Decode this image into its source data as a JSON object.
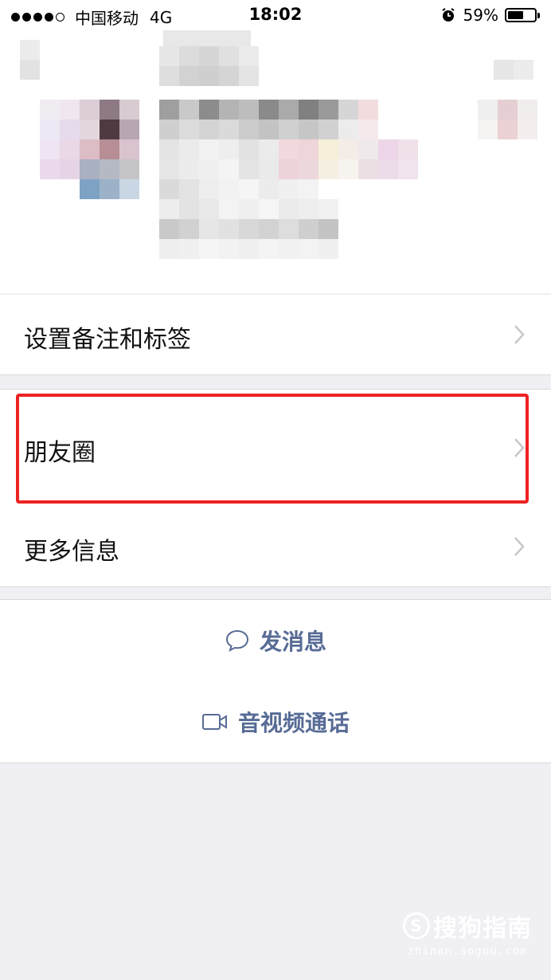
{
  "status_bar": {
    "carrier": "中国移动",
    "network": "4G",
    "time": "18:02",
    "battery_percent_label": "59%",
    "battery_level": 0.59
  },
  "menu": {
    "remark_label": "设置备注和标签",
    "moments_label": "朋友圈",
    "more_info_label": "更多信息"
  },
  "actions": {
    "message_label": "发消息",
    "call_label": "音视频通话"
  },
  "colors": {
    "link": "#576b95",
    "highlight": "#ee2222",
    "background": "#efeff4"
  },
  "watermark": {
    "brand": "搜狗指南",
    "url": "zhinan.sogou.com"
  }
}
